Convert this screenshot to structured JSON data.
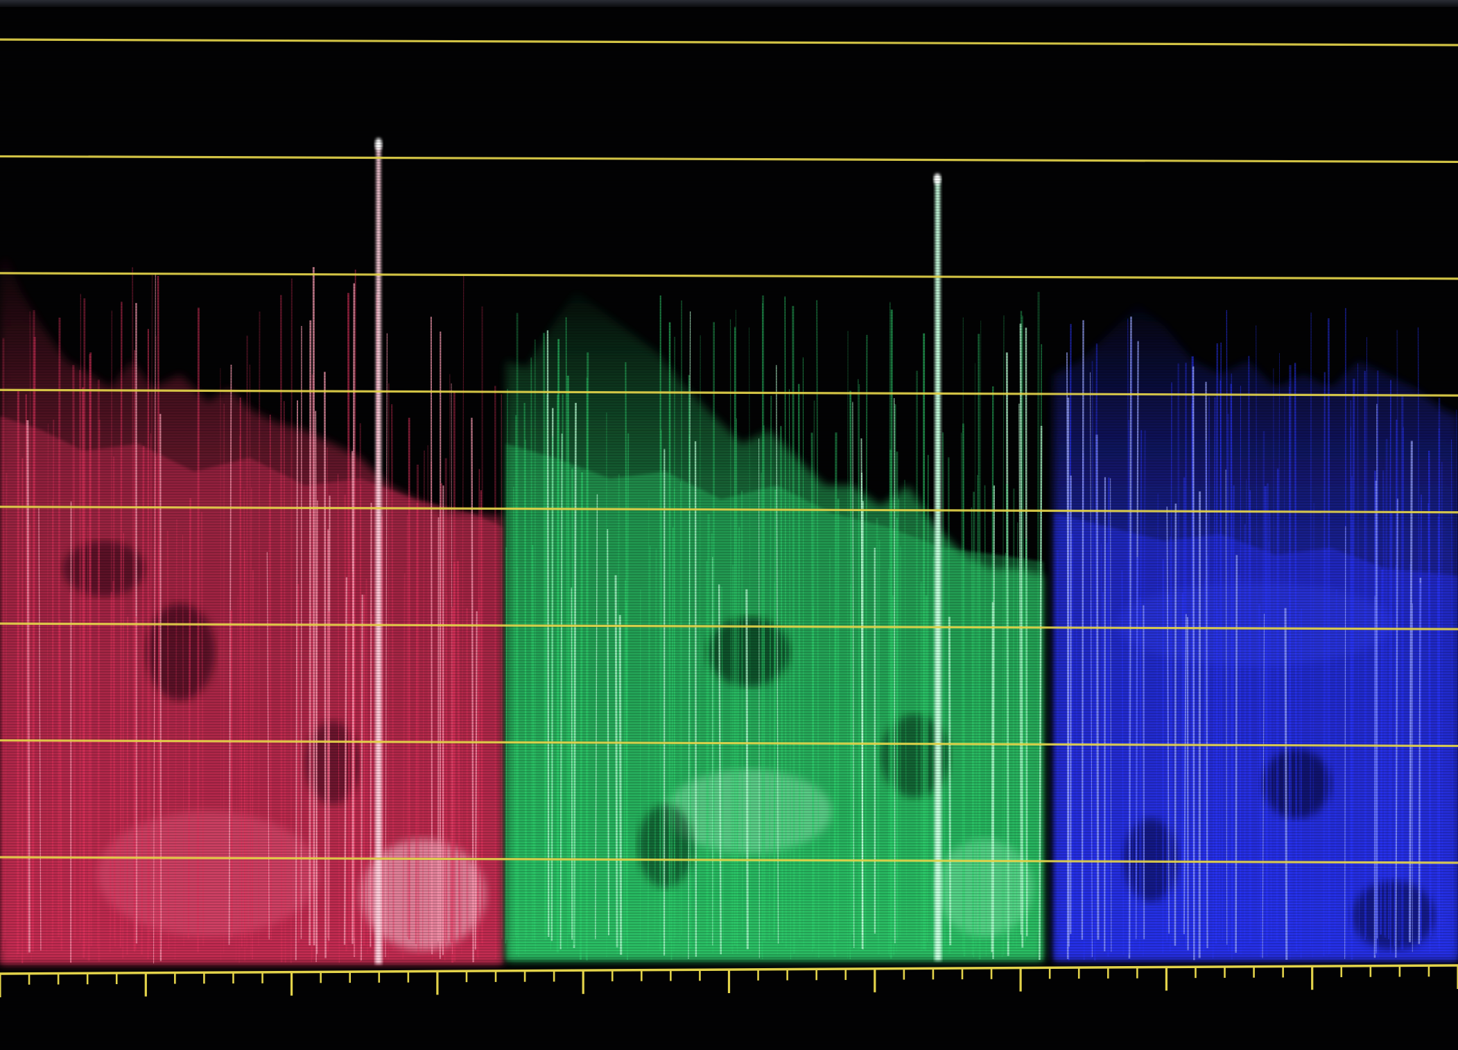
{
  "scope": {
    "type": "rgb-parade-waveform",
    "background_color": "#020203",
    "graticule_color": "#e3d34a",
    "graticule_line_count": 8,
    "baseline_ticks": {
      "major_count": 11,
      "minor_per_major": 4
    },
    "channels": [
      {
        "channel": "red",
        "color": "#e0335d",
        "highlight": "#ff9fb6"
      },
      {
        "channel": "green",
        "color": "#2fd46f",
        "highlight": "#b9ffd4"
      },
      {
        "channel": "blue",
        "color": "#2a36ff",
        "highlight": "#9aa6ff"
      }
    ]
  }
}
